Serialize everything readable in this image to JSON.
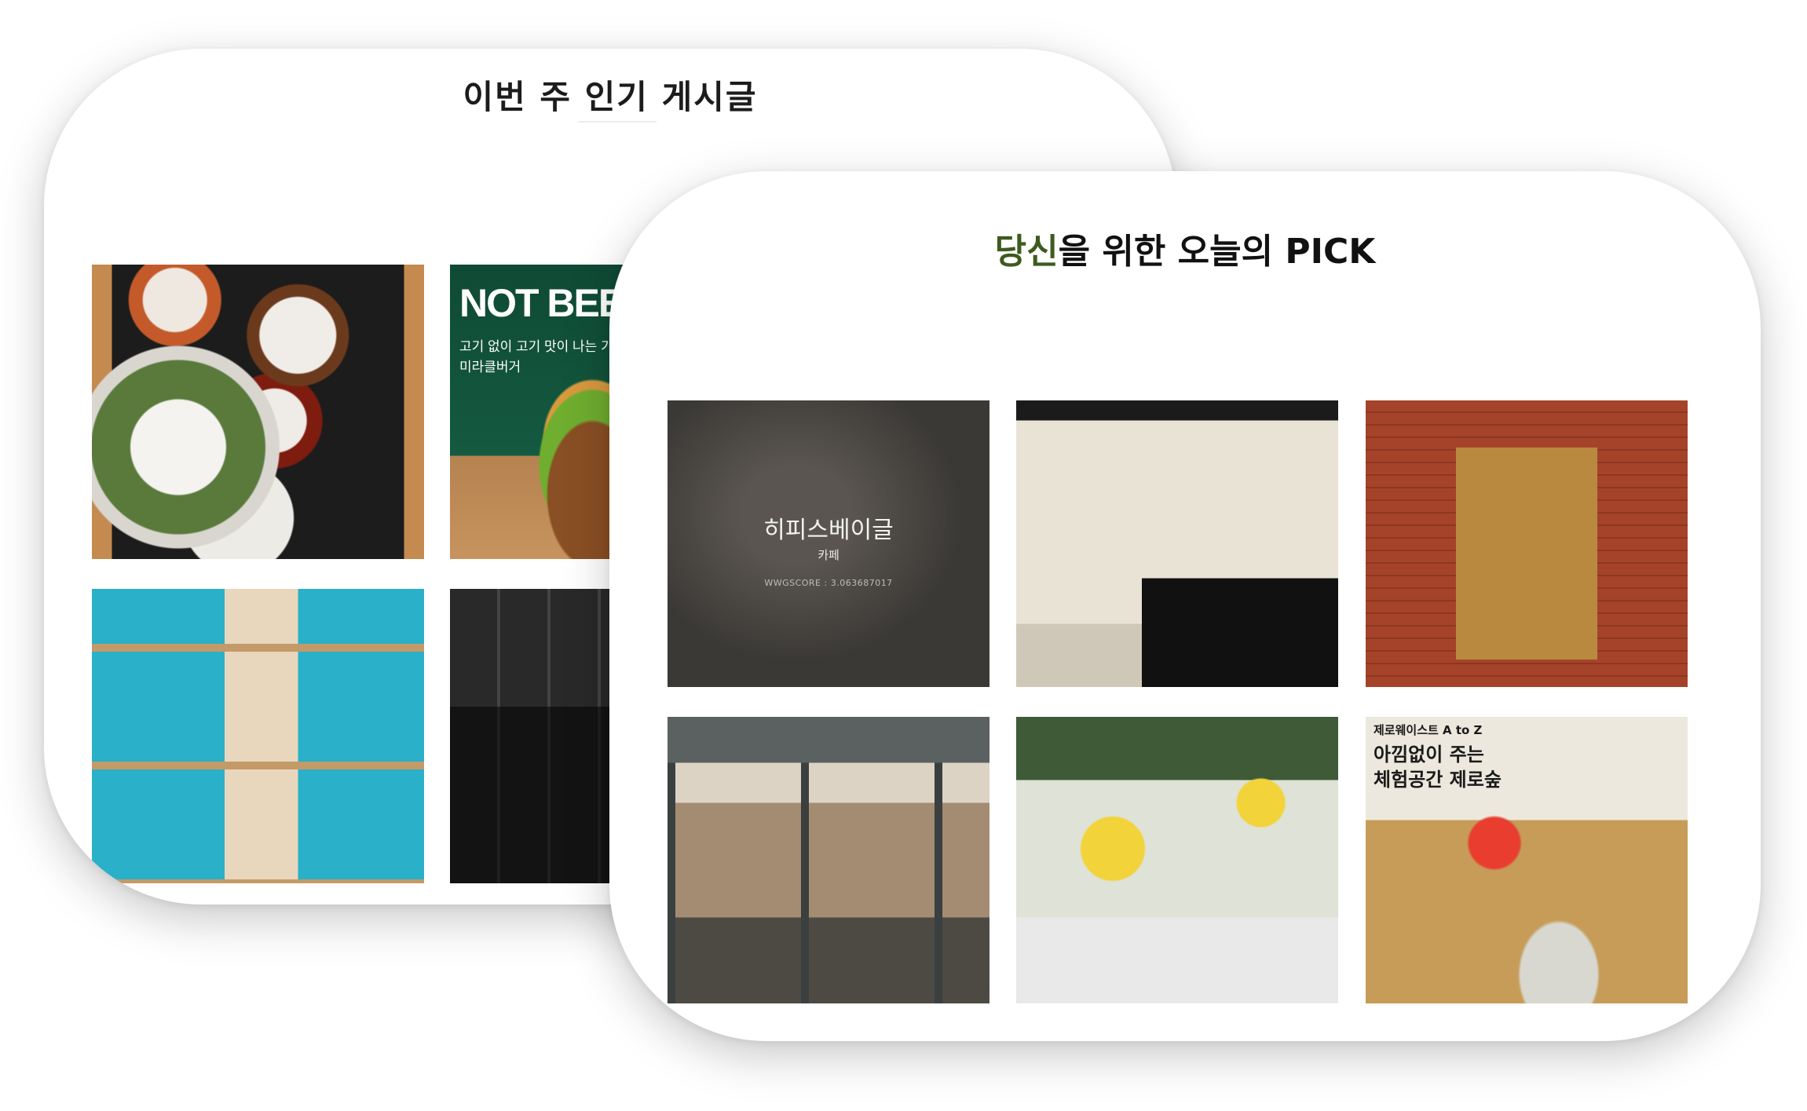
{
  "popular_card": {
    "title": "이번 주 인기 게시글",
    "posts": [
      {
        "image": "korean-meal-tray"
      },
      {
        "image": "burger-ad",
        "headline": "NOT BEEF,",
        "line1": "고기 없이 고기 맛이 나는 기",
        "line2": "미라클버거"
      },
      {
        "image": "zero-waste-shop-shelves"
      },
      {
        "image": "refill-station"
      }
    ]
  },
  "pick_card": {
    "title_accent": "당신",
    "title_rest": "을 위한 오늘의 PICK",
    "accent_color": "#3f5a1e",
    "items": [
      {
        "name": "히피스베이글",
        "category": "카페",
        "score": "WWGSCORE : 3.063687017"
      },
      {
        "image": "bakery-counter"
      },
      {
        "image": "brick-storefront-icecream"
      },
      {
        "image": "glass-storefront"
      },
      {
        "image": "refill-store-interior"
      },
      {
        "image": "zero-waste-promo",
        "kicker": "제로웨이스트 A to Z",
        "head1": "아낌없이 주는",
        "head2": "체험공간 제로숲"
      }
    ]
  }
}
